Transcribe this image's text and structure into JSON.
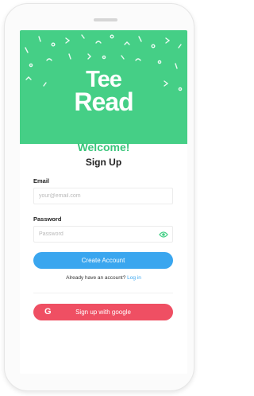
{
  "colors": {
    "hero_green": "#45cf86",
    "welcome_green": "#39c57a",
    "primary_blue": "#3aa6ef",
    "google_red": "#ef4f63"
  },
  "brand": {
    "line1": "Tee",
    "line2": "Read"
  },
  "header": {
    "welcome": "Welcome!",
    "title": "Sign Up"
  },
  "form": {
    "email_label": "Email",
    "email_placeholder": "your@email.com",
    "password_label": "Password",
    "password_placeholder": "Password",
    "password_toggle_icon": "eye-icon",
    "create_button": "Create Account",
    "account_prompt": "Already have an account?",
    "login_link": "Log in",
    "google_icon_letter": "G",
    "google_button": "Sign up with google"
  }
}
